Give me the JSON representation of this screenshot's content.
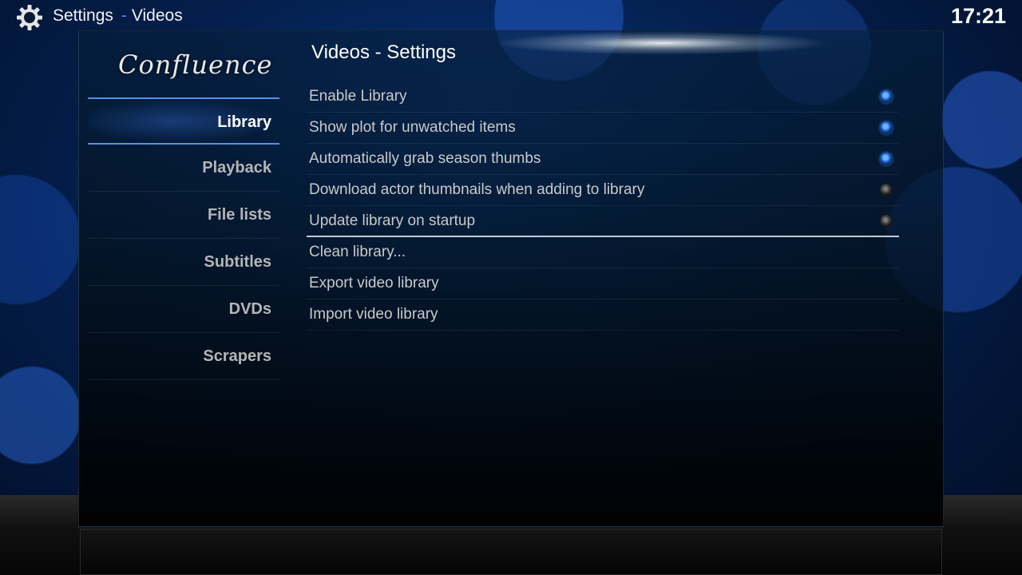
{
  "header": {
    "section": "Settings",
    "separator": "-",
    "subsection": "Videos",
    "icon": "gear-icon",
    "clock": "17:21"
  },
  "logo": {
    "text": "Confluence"
  },
  "sidebar": {
    "items": [
      {
        "label": "Library",
        "active": true
      },
      {
        "label": "Playback",
        "active": false
      },
      {
        "label": "File lists",
        "active": false
      },
      {
        "label": "Subtitles",
        "active": false
      },
      {
        "label": "DVDs",
        "active": false
      },
      {
        "label": "Scrapers",
        "active": false
      }
    ]
  },
  "panel": {
    "title": "Videos - Settings",
    "settings": [
      {
        "label": "Enable Library",
        "type": "toggle",
        "enabled": true
      },
      {
        "label": "Show plot for unwatched items",
        "type": "toggle",
        "enabled": true
      },
      {
        "label": "Automatically grab season thumbs",
        "type": "toggle",
        "enabled": true
      },
      {
        "label": "Download actor thumbnails when adding to library",
        "type": "toggle",
        "enabled": false
      },
      {
        "label": "Update library on startup",
        "type": "toggle",
        "enabled": false,
        "focused": true
      },
      {
        "label": "Clean library...",
        "type": "action"
      },
      {
        "label": "Export video library",
        "type": "action"
      },
      {
        "label": "Import video library",
        "type": "action"
      }
    ]
  },
  "colors": {
    "accent": "#4f8cff",
    "toggle_on": "#1f6be0",
    "toggle_off": "#3a3a3a"
  }
}
